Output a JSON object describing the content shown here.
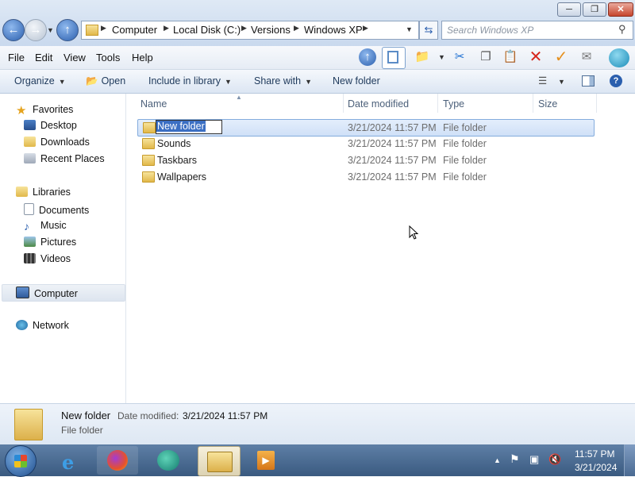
{
  "window": {
    "caption_buttons": [
      "minimize-icon",
      "maximize-icon",
      "close-icon"
    ]
  },
  "navigation": {
    "breadcrumb": [
      "Computer",
      "Local Disk (C:)",
      "Versions",
      "Windows XP"
    ],
    "search_placeholder": "Search Windows XP"
  },
  "menubar": {
    "items": [
      "File",
      "Edit",
      "View",
      "Tools",
      "Help"
    ]
  },
  "commandbar": {
    "organize": "Organize",
    "open": "Open",
    "include_in_library": "Include in library",
    "share_with": "Share with",
    "new_folder": "New folder"
  },
  "nav_pane": {
    "favorites": "Favorites",
    "desktop": "Desktop",
    "downloads": "Downloads",
    "recent_places": "Recent Places",
    "libraries": "Libraries",
    "documents": "Documents",
    "music": "Music",
    "pictures": "Pictures",
    "videos": "Videos",
    "computer": "Computer",
    "network": "Network"
  },
  "columns": {
    "name": "Name",
    "date_modified": "Date modified",
    "type": "Type",
    "size": "Size"
  },
  "files": [
    {
      "name": "New folder",
      "date": "3/21/2024 11:57 PM",
      "type": "File folder"
    },
    {
      "name": "Sounds",
      "date": "3/21/2024 11:57 PM",
      "type": "File folder"
    },
    {
      "name": "Taskbars",
      "date": "3/21/2024 11:57 PM",
      "type": "File folder"
    },
    {
      "name": "Wallpapers",
      "date": "3/21/2024 11:57 PM",
      "type": "File folder"
    }
  ],
  "details": {
    "name": "New folder",
    "date_label": "Date modified:",
    "date_value": "3/21/2024 11:57 PM",
    "type": "File folder"
  },
  "taskbar": {
    "time": "11:57 PM",
    "date": "3/21/2024"
  },
  "colors": {
    "selection": "#cfe0f7",
    "accent": "#2b5fae"
  }
}
